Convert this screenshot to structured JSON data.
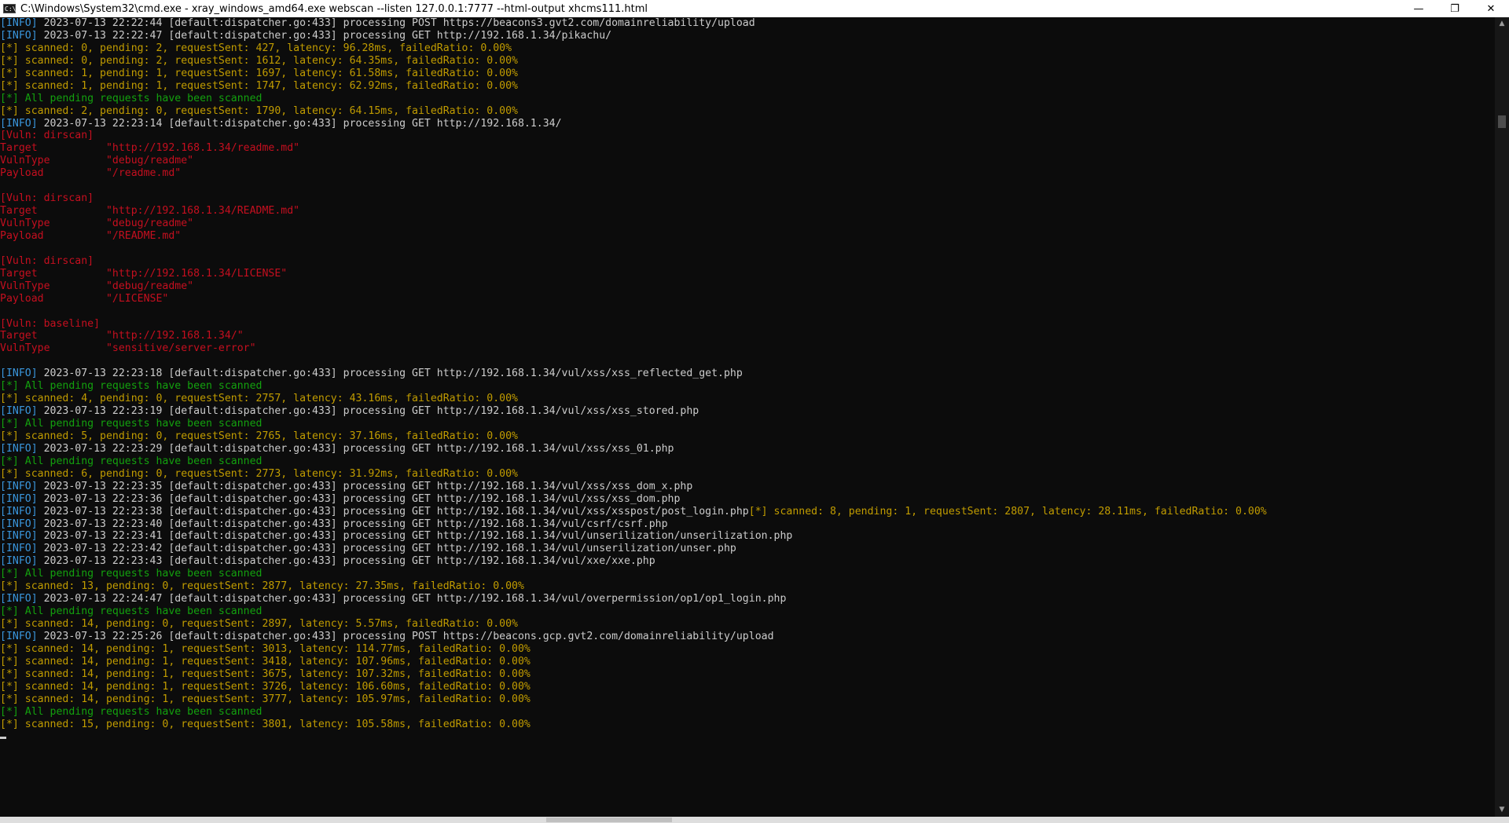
{
  "window": {
    "title": "C:\\Windows\\System32\\cmd.exe - xray_windows_amd64.exe  webscan --listen 127.0.0.1:7777 --html-output xhcms111.html",
    "icon_label": "C:\\",
    "minimize_glyph": "—",
    "maximize_glyph": "❐",
    "close_glyph": "✕"
  },
  "scrollbar": {
    "up_glyph": "▲",
    "down_glyph": "▼"
  },
  "colors": {
    "background": "#0c0c0c",
    "info": "#3a96dd",
    "text": "#cccccc",
    "green": "#13a10e",
    "yellow": "#c19c00",
    "red": "#c50f1f"
  },
  "console": {
    "lines": [
      [
        {
          "c": "c-info",
          "t": "[INFO]"
        },
        {
          "c": "c-gray",
          "t": " 2023-07-13 22:22:44 [default:dispatcher.go:433] processing POST https://beacons3.gvt2.com/domainreliability/upload"
        }
      ],
      [
        {
          "c": "c-info",
          "t": "[INFO]"
        },
        {
          "c": "c-gray",
          "t": " 2023-07-13 22:22:47 [default:dispatcher.go:433] processing GET http://192.168.1.34/pikachu/"
        }
      ],
      [
        {
          "c": "c-yellow",
          "t": "[*] scanned: 0, pending: 2, requestSent: 427, latency: 96.28ms, failedRatio: 0.00%"
        }
      ],
      [
        {
          "c": "c-yellow",
          "t": "[*] scanned: 0, pending: 2, requestSent: 1612, latency: 64.35ms, failedRatio: 0.00%"
        }
      ],
      [
        {
          "c": "c-yellow",
          "t": "[*] scanned: 1, pending: 1, requestSent: 1697, latency: 61.58ms, failedRatio: 0.00%"
        }
      ],
      [
        {
          "c": "c-yellow",
          "t": "[*] scanned: 1, pending: 1, requestSent: 1747, latency: 62.92ms, failedRatio: 0.00%"
        }
      ],
      [
        {
          "c": "c-green",
          "t": "[*] All pending requests have been scanned"
        }
      ],
      [
        {
          "c": "c-yellow",
          "t": "[*] scanned: 2, pending: 0, requestSent: 1790, latency: 64.15ms, failedRatio: 0.00%"
        }
      ],
      [
        {
          "c": "c-info",
          "t": "[INFO]"
        },
        {
          "c": "c-gray",
          "t": " 2023-07-13 22:23:14 [default:dispatcher.go:433] processing GET http://192.168.1.34/"
        }
      ],
      [
        {
          "c": "c-red",
          "t": "[Vuln: dirscan]"
        }
      ],
      [
        {
          "c": "c-red",
          "t": "Target           \"http://192.168.1.34/readme.md\""
        }
      ],
      [
        {
          "c": "c-red",
          "t": "VulnType         \"debug/readme\""
        }
      ],
      [
        {
          "c": "c-red",
          "t": "Payload          \"/readme.md\""
        }
      ],
      [
        {
          "c": "c-gray",
          "t": ""
        }
      ],
      [
        {
          "c": "c-red",
          "t": "[Vuln: dirscan]"
        }
      ],
      [
        {
          "c": "c-red",
          "t": "Target           \"http://192.168.1.34/README.md\""
        }
      ],
      [
        {
          "c": "c-red",
          "t": "VulnType         \"debug/readme\""
        }
      ],
      [
        {
          "c": "c-red",
          "t": "Payload          \"/README.md\""
        }
      ],
      [
        {
          "c": "c-gray",
          "t": ""
        }
      ],
      [
        {
          "c": "c-red",
          "t": "[Vuln: dirscan]"
        }
      ],
      [
        {
          "c": "c-red",
          "t": "Target           \"http://192.168.1.34/LICENSE\""
        }
      ],
      [
        {
          "c": "c-red",
          "t": "VulnType         \"debug/readme\""
        }
      ],
      [
        {
          "c": "c-red",
          "t": "Payload          \"/LICENSE\""
        }
      ],
      [
        {
          "c": "c-gray",
          "t": ""
        }
      ],
      [
        {
          "c": "c-red",
          "t": "[Vuln: baseline]"
        }
      ],
      [
        {
          "c": "c-red",
          "t": "Target           \"http://192.168.1.34/\""
        }
      ],
      [
        {
          "c": "c-red",
          "t": "VulnType         \"sensitive/server-error\""
        }
      ],
      [
        {
          "c": "c-gray",
          "t": ""
        }
      ],
      [
        {
          "c": "c-info",
          "t": "[INFO]"
        },
        {
          "c": "c-gray",
          "t": " 2023-07-13 22:23:18 [default:dispatcher.go:433] processing GET http://192.168.1.34/vul/xss/xss_reflected_get.php"
        }
      ],
      [
        {
          "c": "c-green",
          "t": "[*] All pending requests have been scanned"
        }
      ],
      [
        {
          "c": "c-yellow",
          "t": "[*] scanned: 4, pending: 0, requestSent: 2757, latency: 43.16ms, failedRatio: 0.00%"
        }
      ],
      [
        {
          "c": "c-info",
          "t": "[INFO]"
        },
        {
          "c": "c-gray",
          "t": " 2023-07-13 22:23:19 [default:dispatcher.go:433] processing GET http://192.168.1.34/vul/xss/xss_stored.php"
        }
      ],
      [
        {
          "c": "c-green",
          "t": "[*] All pending requests have been scanned"
        }
      ],
      [
        {
          "c": "c-yellow",
          "t": "[*] scanned: 5, pending: 0, requestSent: 2765, latency: 37.16ms, failedRatio: 0.00%"
        }
      ],
      [
        {
          "c": "c-info",
          "t": "[INFO]"
        },
        {
          "c": "c-gray",
          "t": " 2023-07-13 22:23:29 [default:dispatcher.go:433] processing GET http://192.168.1.34/vul/xss/xss_01.php"
        }
      ],
      [
        {
          "c": "c-green",
          "t": "[*] All pending requests have been scanned"
        }
      ],
      [
        {
          "c": "c-yellow",
          "t": "[*] scanned: 6, pending: 0, requestSent: 2773, latency: 31.92ms, failedRatio: 0.00%"
        }
      ],
      [
        {
          "c": "c-info",
          "t": "[INFO]"
        },
        {
          "c": "c-gray",
          "t": " 2023-07-13 22:23:35 [default:dispatcher.go:433] processing GET http://192.168.1.34/vul/xss/xss_dom_x.php"
        }
      ],
      [
        {
          "c": "c-info",
          "t": "[INFO]"
        },
        {
          "c": "c-gray",
          "t": " 2023-07-13 22:23:36 [default:dispatcher.go:433] processing GET http://192.168.1.34/vul/xss/xss_dom.php"
        }
      ],
      [
        {
          "c": "c-info",
          "t": "[INFO]"
        },
        {
          "c": "c-gray",
          "t": " 2023-07-13 22:23:38 [default:dispatcher.go:433] processing GET http://192.168.1.34/vul/xss/xsspost/post_login.php"
        },
        {
          "c": "c-yellow",
          "t": "[*] scanned: 8, pending: 1, requestSent: 2807, latency: 28.11ms, failedRatio: 0.00%"
        }
      ],
      [
        {
          "c": "c-info",
          "t": "[INFO]"
        },
        {
          "c": "c-gray",
          "t": " 2023-07-13 22:23:40 [default:dispatcher.go:433] processing GET http://192.168.1.34/vul/csrf/csrf.php"
        }
      ],
      [
        {
          "c": "c-info",
          "t": "[INFO]"
        },
        {
          "c": "c-gray",
          "t": " 2023-07-13 22:23:41 [default:dispatcher.go:433] processing GET http://192.168.1.34/vul/unserilization/unserilization.php"
        }
      ],
      [
        {
          "c": "c-info",
          "t": "[INFO]"
        },
        {
          "c": "c-gray",
          "t": " 2023-07-13 22:23:42 [default:dispatcher.go:433] processing GET http://192.168.1.34/vul/unserilization/unser.php"
        }
      ],
      [
        {
          "c": "c-info",
          "t": "[INFO]"
        },
        {
          "c": "c-gray",
          "t": " 2023-07-13 22:23:43 [default:dispatcher.go:433] processing GET http://192.168.1.34/vul/xxe/xxe.php"
        }
      ],
      [
        {
          "c": "c-green",
          "t": "[*] All pending requests have been scanned"
        }
      ],
      [
        {
          "c": "c-yellow",
          "t": "[*] scanned: 13, pending: 0, requestSent: 2877, latency: 27.35ms, failedRatio: 0.00%"
        }
      ],
      [
        {
          "c": "c-info",
          "t": "[INFO]"
        },
        {
          "c": "c-gray",
          "t": " 2023-07-13 22:24:47 [default:dispatcher.go:433] processing GET http://192.168.1.34/vul/overpermission/op1/op1_login.php"
        }
      ],
      [
        {
          "c": "c-green",
          "t": "[*] All pending requests have been scanned"
        }
      ],
      [
        {
          "c": "c-yellow",
          "t": "[*] scanned: 14, pending: 0, requestSent: 2897, latency: 5.57ms, failedRatio: 0.00%"
        }
      ],
      [
        {
          "c": "c-info",
          "t": "[INFO]"
        },
        {
          "c": "c-gray",
          "t": " 2023-07-13 22:25:26 [default:dispatcher.go:433] processing POST https://beacons.gcp.gvt2.com/domainreliability/upload"
        }
      ],
      [
        {
          "c": "c-yellow",
          "t": "[*] scanned: 14, pending: 1, requestSent: 3013, latency: 114.77ms, failedRatio: 0.00%"
        }
      ],
      [
        {
          "c": "c-yellow",
          "t": "[*] scanned: 14, pending: 1, requestSent: 3418, latency: 107.96ms, failedRatio: 0.00%"
        }
      ],
      [
        {
          "c": "c-yellow",
          "t": "[*] scanned: 14, pending: 1, requestSent: 3675, latency: 107.32ms, failedRatio: 0.00%"
        }
      ],
      [
        {
          "c": "c-yellow",
          "t": "[*] scanned: 14, pending: 1, requestSent: 3726, latency: 106.60ms, failedRatio: 0.00%"
        }
      ],
      [
        {
          "c": "c-yellow",
          "t": "[*] scanned: 14, pending: 1, requestSent: 3777, latency: 105.97ms, failedRatio: 0.00%"
        }
      ],
      [
        {
          "c": "c-green",
          "t": "[*] All pending requests have been scanned"
        }
      ],
      [
        {
          "c": "c-yellow",
          "t": "[*] scanned: 15, pending: 0, requestSent: 3801, latency: 105.58ms, failedRatio: 0.00%"
        }
      ]
    ]
  }
}
